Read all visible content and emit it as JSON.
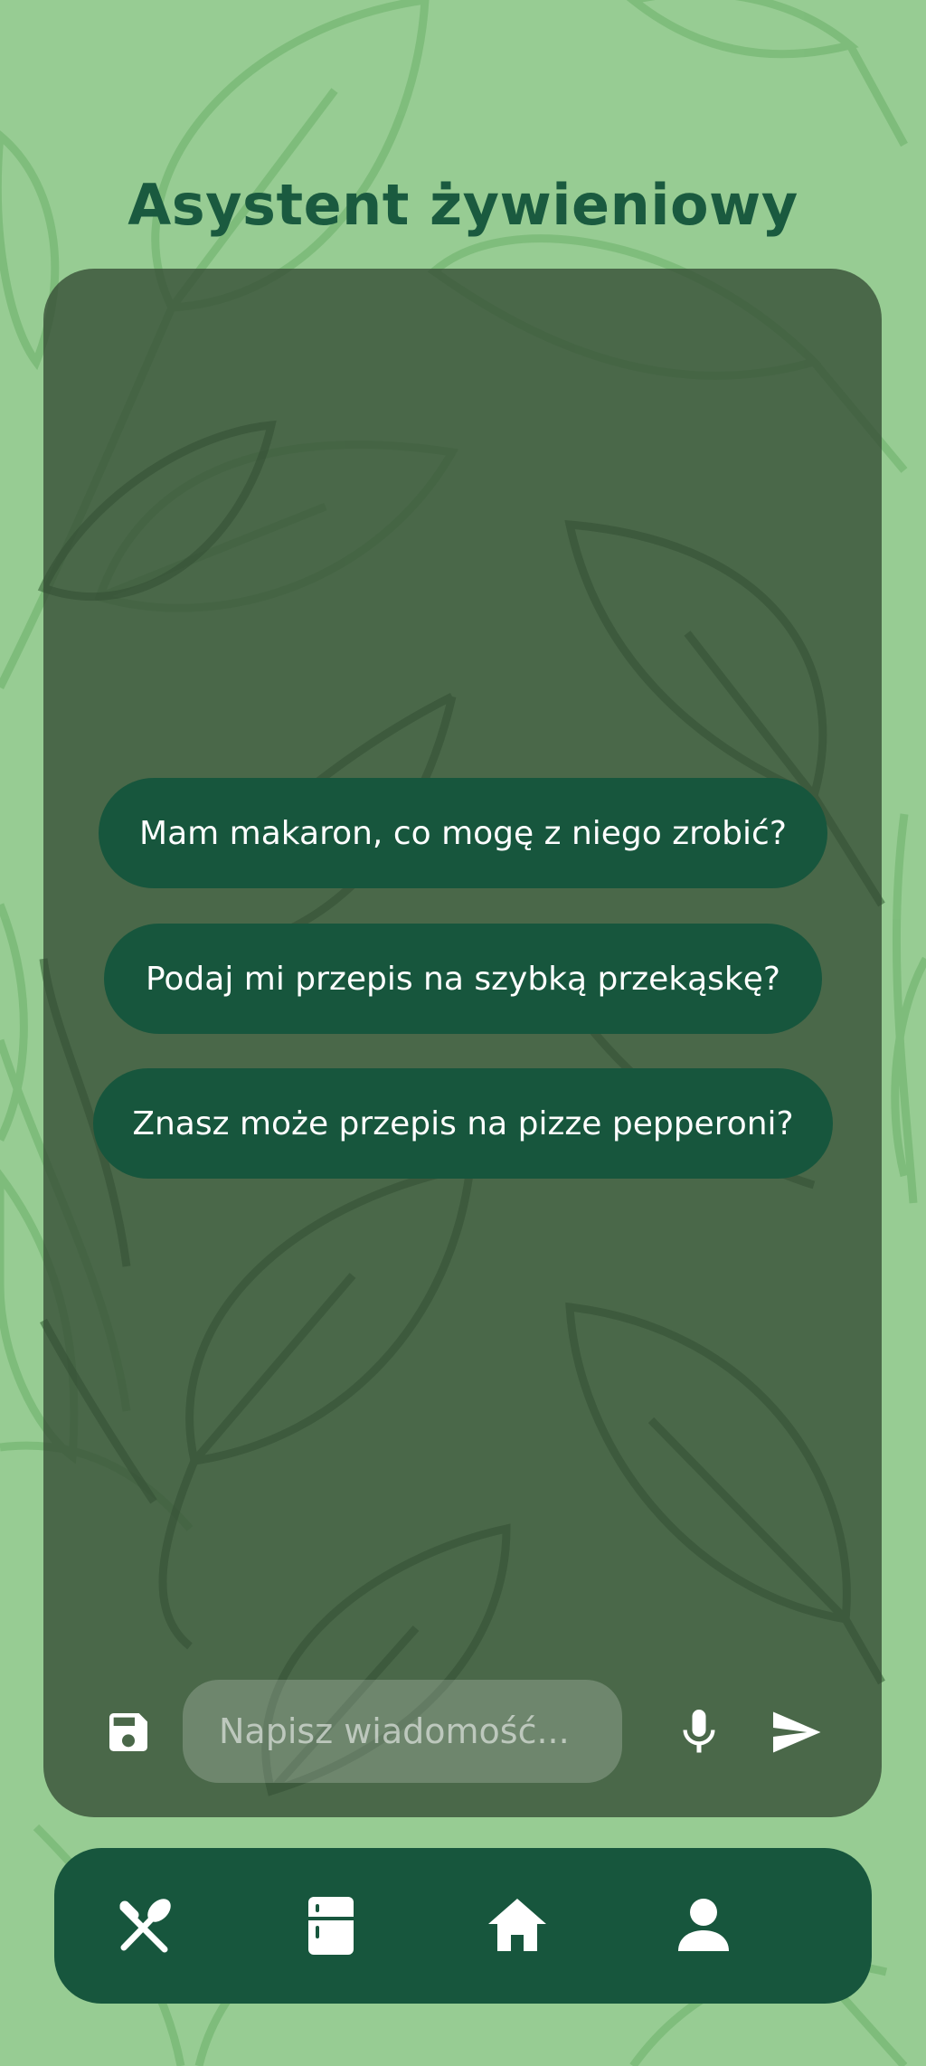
{
  "header": {
    "title": "Asystent żywieniowy"
  },
  "suggestions": [
    {
      "label": "Mam makaron, co mogę z niego zrobić?"
    },
    {
      "label": "Podaj mi przepis na szybką przekąskę?"
    },
    {
      "label": "Znasz może przepis na pizze pepperoni?"
    }
  ],
  "composer": {
    "placeholder": "Napisz wiadomość...",
    "save_icon": "save-icon",
    "mic_icon": "microphone-icon",
    "send_icon": "send-icon"
  },
  "bottom_nav": {
    "items": [
      {
        "icon": "cutlery-icon"
      },
      {
        "icon": "fridge-icon"
      },
      {
        "icon": "home-icon"
      },
      {
        "icon": "person-icon"
      }
    ]
  },
  "colors": {
    "background": "#97cc93",
    "primary_dark": "#17563d",
    "title": "#1a5a3f",
    "panel": "#344b34"
  }
}
